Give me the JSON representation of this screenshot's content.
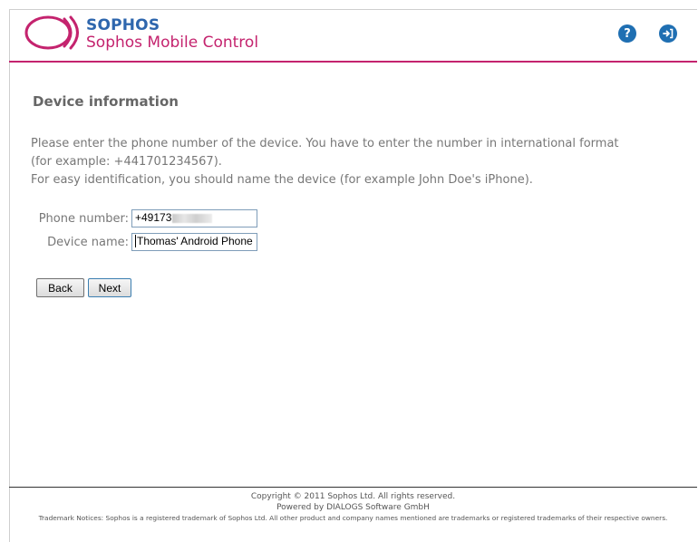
{
  "header": {
    "brand": "SOPHOS",
    "product": "Sophos Mobile Control",
    "help_icon": "help-icon",
    "logout_icon": "logout-icon",
    "accent_color": "#c4236e",
    "brand_color": "#2e66ad"
  },
  "main": {
    "title": "Device information",
    "instructions": [
      "Please enter the phone number of the device. You have to enter the number in international format",
      "(for example: +441701234567).",
      "For easy identification, you should name the device (for example John Doe's iPhone)."
    ],
    "phone": {
      "label": "Phone number:",
      "value": "+49173"
    },
    "device": {
      "label": "Device name:",
      "value": "Thomas' Android Phone"
    },
    "buttons": {
      "back": "Back",
      "next": "Next"
    }
  },
  "footer": {
    "copyright": "Copyright © 2011 Sophos Ltd. All rights reserved.",
    "powered": "Powered by DIALOGS Software GmbH",
    "trademark": "Trademark Notices: Sophos is a registered trademark of Sophos Ltd. All other product and company names mentioned are trademarks or registered trademarks of their respective owners."
  }
}
